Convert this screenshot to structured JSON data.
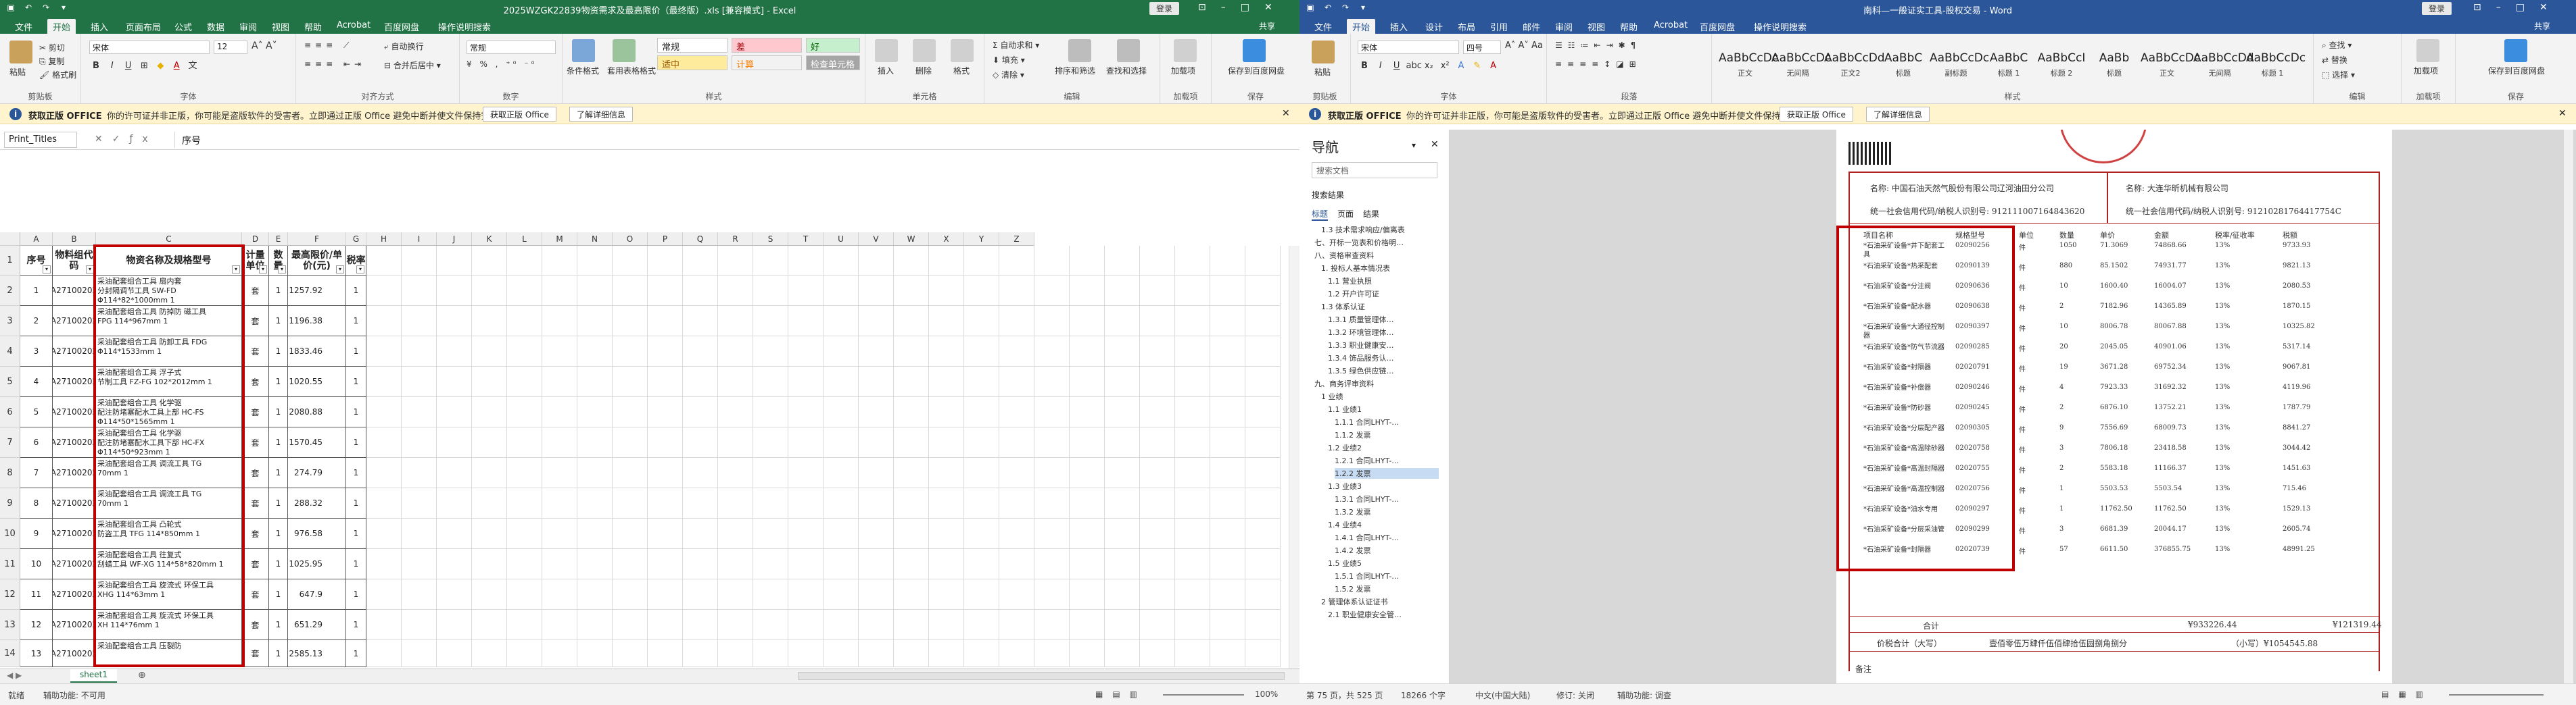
{
  "excel": {
    "title": "2025WZGK22839物资需求及最高限价（最终版）.xls [兼容模式] - Excel",
    "login": "登录",
    "tabs": [
      "文件",
      "开始",
      "插入",
      "页面布局",
      "公式",
      "数据",
      "审阅",
      "视图",
      "帮助",
      "Acrobat",
      "百度网盘",
      "操作说明搜索"
    ],
    "share": "共享",
    "ribbon": {
      "clipboard": {
        "paste": "粘贴",
        "cut": "剪切",
        "copy": "复制",
        "painter": "格式刷",
        "label": "剪贴板"
      },
      "font": {
        "name": "宋体",
        "size": "12",
        "label": "字体"
      },
      "align": {
        "wrap": "自动换行",
        "merge": "合并后居中",
        "label": "对齐方式"
      },
      "number": {
        "format": "常规",
        "label": "数字"
      },
      "styles": {
        "cond": "条件格式",
        "table": "套用表格格式",
        "normal": "常规",
        "bad": "差",
        "good": "好",
        "neutral": "适中",
        "calc": "计算",
        "check": "检查单元格",
        "label": "样式"
      },
      "cells": {
        "insert": "插入",
        "delete": "删除",
        "format": "格式",
        "label": "单元格"
      },
      "edit": {
        "autosum": "自动求和",
        "fill": "填充",
        "clear": "清除",
        "sort": "排序和筛选",
        "find": "查找和选择",
        "label": "编辑"
      },
      "addin": {
        "btn": "加载项",
        "label": "加载项"
      },
      "save": {
        "btn": "保存到百度网盘",
        "label": "保存"
      }
    },
    "msgbar": {
      "title": "获取正版 OFFICE",
      "text": "你的许可证并非正版，你可能是盗版软件的受害者。立即通过正版 Office 避免中断并使文件保持安全。",
      "btn1": "获取正版 Office",
      "btn2": "了解详细信息"
    },
    "namebox": "Print_Titles",
    "formula": "序号",
    "columns": [
      "A",
      "B",
      "C",
      "D",
      "E",
      "F",
      "G",
      "H",
      "I",
      "J",
      "K",
      "L",
      "M",
      "N",
      "O",
      "P",
      "Q",
      "R",
      "S",
      "T",
      "U",
      "V",
      "W",
      "X",
      "Y",
      "Z"
    ],
    "headers": [
      "序号",
      "物料组代码",
      "物资名称及规格型号",
      "计量单位",
      "数量",
      "最高限价/单价(元)",
      "税率"
    ],
    "rows": [
      {
        "no": "1",
        "code": "A27100202",
        "name": "采油配套组合工具 扇内套\n分封隔调节工具 SW-FD\nΦ114*82*1000mm 1",
        "unit": "套",
        "qty": "1",
        "price": "1257.92",
        "tax": "1"
      },
      {
        "no": "2",
        "code": "A27100202",
        "name": "采油配套组合工具 防掉防 磁工具\nFPG 114*967mm 1",
        "unit": "套",
        "qty": "1",
        "price": "1196.38",
        "tax": "1"
      },
      {
        "no": "3",
        "code": "A27100202",
        "name": "采油配套组合工具 防卸工具 FDG\nΦ114*1533mm 1",
        "unit": "套",
        "qty": "1",
        "price": "1833.46",
        "tax": "1"
      },
      {
        "no": "4",
        "code": "A27100202",
        "name": "采油配套组合工具 浮子式\n节制工具 FZ-FG 102*2012mm 1",
        "unit": "套",
        "qty": "1",
        "price": "1020.55",
        "tax": "1"
      },
      {
        "no": "5",
        "code": "A27100202",
        "name": "采油配套组合工具 化学驱\n配注防堵塞配水工具上部 HC-FS\nΦ114*50*1565mm 1",
        "unit": "套",
        "qty": "1",
        "price": "2080.88",
        "tax": "1"
      },
      {
        "no": "6",
        "code": "A27100202",
        "name": "采油配套组合工具 化学驱\n配注防堵塞配水工具下部 HC-FX\nΦ114*50*923mm 1",
        "unit": "套",
        "qty": "1",
        "price": "1570.45",
        "tax": "1"
      },
      {
        "no": "7",
        "code": "A27100202",
        "name": "采油配套组合工具 调流工具 TG\n70mm 1",
        "unit": "套",
        "qty": "1",
        "price": "274.79",
        "tax": "1"
      },
      {
        "no": "8",
        "code": "A27100202",
        "name": "采油配套组合工具 调流工具 TG\n70mm 1",
        "unit": "套",
        "qty": "1",
        "price": "288.32",
        "tax": "1"
      },
      {
        "no": "9",
        "code": "A27100202",
        "name": "采油配套组合工具 凸轮式\n防盗工具 TFG 114*850mm 1",
        "unit": "套",
        "qty": "1",
        "price": "976.58",
        "tax": "1"
      },
      {
        "no": "10",
        "code": "A27100202",
        "name": "采油配套组合工具 往复式\n刮蜡工具 WF-XG 114*58*820mm 1",
        "unit": "套",
        "qty": "1",
        "price": "1025.95",
        "tax": "1"
      },
      {
        "no": "11",
        "code": "A27100202",
        "name": "采油配套组合工具 旋流式 环保工具\nXHG 114*63mm 1",
        "unit": "套",
        "qty": "1",
        "price": "647.9",
        "tax": "1"
      },
      {
        "no": "12",
        "code": "A27100202",
        "name": "采油配套组合工具 旋流式 环保工具\nXH 114*76mm 1",
        "unit": "套",
        "qty": "1",
        "price": "651.29",
        "tax": "1"
      },
      {
        "no": "13",
        "code": "A27100202",
        "name": "采油配套组合工具 压裂防",
        "unit": "套",
        "qty": "1",
        "price": "2585.13",
        "tax": "1"
      }
    ],
    "sheet": "sheet1",
    "status": {
      "ready": "就绪",
      "access": "辅助功能: 不可用",
      "zoom": "100%"
    }
  },
  "word": {
    "title": "南科—一般证实工具-股权交易 - Word",
    "login": "登录",
    "tabs": [
      "文件",
      "开始",
      "插入",
      "设计",
      "布局",
      "引用",
      "邮件",
      "审阅",
      "视图",
      "帮助",
      "Acrobat",
      "百度网盘",
      "操作说明搜索"
    ],
    "share": "共享",
    "ribbon": {
      "clipboard": {
        "paste": "粘贴",
        "label": "剪贴板"
      },
      "font": {
        "name": "宋体",
        "size": "四号",
        "label": "字体"
      },
      "para": {
        "label": "段落"
      },
      "styles": {
        "items": [
          {
            "prev": "AaBbCcDc",
            "name": "正文"
          },
          {
            "prev": "AaBbCcDc",
            "name": "无间隔"
          },
          {
            "prev": "AaBbCcDd",
            "name": "正文2"
          },
          {
            "prev": "AaBbC",
            "name": "标题"
          },
          {
            "prev": "AaBbCcDc",
            "name": "副标题"
          },
          {
            "prev": "AaBbC",
            "name": "标题 1"
          },
          {
            "prev": "AaBbCcI",
            "name": "标题 2"
          },
          {
            "prev": "AaBb",
            "name": "标题"
          },
          {
            "prev": "AaBbCcDc",
            "name": "正文"
          },
          {
            "prev": "AaBbCcDd",
            "name": "无间隔"
          },
          {
            "prev": "AaBbCcDc",
            "name": "标题 1"
          }
        ],
        "label": "样式"
      },
      "edit": {
        "find": "查找",
        "replace": "替换",
        "select": "选择",
        "label": "编辑"
      },
      "addin": {
        "btn": "加载项",
        "label": "加载项"
      },
      "save": {
        "btn": "保存到百度网盘",
        "label": "保存"
      }
    },
    "msgbar": {
      "title": "获取正版 OFFICE",
      "text": "你的许可证并非正版，你可能是盗版软件的受害者。立即通过正版 Office 避免中断并使文件保持安全。",
      "btn1": "获取正版 Office",
      "btn2": "了解详细信息"
    },
    "nav": {
      "title": "导航",
      "search": "搜索文档",
      "results": "搜索结果",
      "tabs": [
        "标题",
        "页面",
        "结果"
      ],
      "items": [
        {
          "text": "1.3 技术需求响应/偏离表",
          "lvl": 2
        },
        {
          "text": "七、开标一览表和价格明…",
          "lvl": 1
        },
        {
          "text": "八、资格审查资料",
          "lvl": 1
        },
        {
          "text": "1. 投标人基本情况表",
          "lvl": 2
        },
        {
          "text": "1.1 营业执照",
          "lvl": 3
        },
        {
          "text": "1.2 开户许可证",
          "lvl": 3
        },
        {
          "text": "1.3 体系认证",
          "lvl": 2
        },
        {
          "text": "1.3.1 质量管理体…",
          "lvl": 3
        },
        {
          "text": "1.3.2 环境管理体…",
          "lvl": 3
        },
        {
          "text": "1.3.3 职业健康安…",
          "lvl": 3
        },
        {
          "text": "1.3.4 饰品服务认…",
          "lvl": 3
        },
        {
          "text": "1.3.5 绿色供应链…",
          "lvl": 3
        },
        {
          "text": "九、商务评审资料",
          "lvl": 1
        },
        {
          "text": "1 业绩",
          "lvl": 2
        },
        {
          "text": "1.1 业绩1",
          "lvl": 3
        },
        {
          "text": "1.1.1 合同LHYT-…",
          "lvl": 4
        },
        {
          "text": "1.1.2 发票",
          "lvl": 4
        },
        {
          "text": "1.2 业绩2",
          "lvl": 3
        },
        {
          "text": "1.2.1 合同LHYT-…",
          "lvl": 4
        },
        {
          "text": "1.2.2 发票",
          "lvl": 4,
          "sel": true
        },
        {
          "text": "1.3 业绩3",
          "lvl": 3
        },
        {
          "text": "1.3.1 合同LHYT-…",
          "lvl": 4
        },
        {
          "text": "1.3.2 发票",
          "lvl": 4
        },
        {
          "text": "1.4 业绩4",
          "lvl": 3
        },
        {
          "text": "1.4.1 合同LHYT-…",
          "lvl": 4
        },
        {
          "text": "1.4.2 发票",
          "lvl": 4
        },
        {
          "text": "1.5 业绩5",
          "lvl": 3
        },
        {
          "text": "1.5.1 合同LHYT-…",
          "lvl": 4
        },
        {
          "text": "1.5.2 发票",
          "lvl": 4
        },
        {
          "text": "2 管理体系认证证书",
          "lvl": 2
        },
        {
          "text": "2.1 职业健康安全管…",
          "lvl": 3
        }
      ]
    },
    "invoice": {
      "buyer": "名称: 中国石油天然气股份有限公司辽河油田分公司",
      "buyer_id": "统一社会信用代码/纳税人识别号: 912111007164843620",
      "seller": "名称: 大连华昕机械有限公司",
      "seller_id": "统一社会信用代码/纳税人识别号: 91210281764417754C",
      "cols": [
        "项目名称",
        "规格型号",
        "单位",
        "数量",
        "单价",
        "金额",
        "税率/征收率",
        "税额"
      ],
      "rows": [
        {
          "name": "*石油采矿设备*井下配套工具",
          "model": "02090256",
          "unit": "件",
          "qty": "1050",
          "price": "71.3069",
          "amt": "74868.66",
          "rate": "13%",
          "tax": "9733.93"
        },
        {
          "name": "*石油采矿设备*热采配套",
          "model": "02090139",
          "unit": "件",
          "qty": "880",
          "price": "85.1502",
          "amt": "74931.77",
          "rate": "13%",
          "tax": "9821.13"
        },
        {
          "name": "*石油采矿设备*分注阀",
          "model": "02090636",
          "unit": "件",
          "qty": "10",
          "price": "1600.40",
          "amt": "16004.07",
          "rate": "13%",
          "tax": "2080.53"
        },
        {
          "name": "*石油采矿设备*配水器",
          "model": "02090638",
          "unit": "件",
          "qty": "2",
          "price": "7182.96",
          "amt": "14365.89",
          "rate": "13%",
          "tax": "1870.15"
        },
        {
          "name": "*石油采矿设备*大通径控制器",
          "model": "02090397",
          "unit": "件",
          "qty": "10",
          "price": "8006.78",
          "amt": "80067.88",
          "rate": "13%",
          "tax": "10325.82"
        },
        {
          "name": "*石油采矿设备*防气节流器",
          "model": "02090285",
          "unit": "件",
          "qty": "20",
          "price": "2045.05",
          "amt": "40901.06",
          "rate": "13%",
          "tax": "5317.14"
        },
        {
          "name": "*石油采矿设备*封隔器",
          "model": "02020791",
          "unit": "件",
          "qty": "19",
          "price": "3671.28",
          "amt": "69752.34",
          "rate": "13%",
          "tax": "9067.81"
        },
        {
          "name": "*石油采矿设备*补偿器",
          "model": "02090246",
          "unit": "件",
          "qty": "4",
          "price": "7923.33",
          "amt": "31692.32",
          "rate": "13%",
          "tax": "4119.96"
        },
        {
          "name": "*石油采矿设备*防砂器",
          "model": "02090245",
          "unit": "件",
          "qty": "2",
          "price": "6876.10",
          "amt": "13752.21",
          "rate": "13%",
          "tax": "1787.79"
        },
        {
          "name": "*石油采矿设备*分层配产器",
          "model": "02090305",
          "unit": "件",
          "qty": "9",
          "price": "7556.69",
          "amt": "68009.73",
          "rate": "13%",
          "tax": "8841.27"
        },
        {
          "name": "*石油采矿设备*高温除砂器",
          "model": "02020758",
          "unit": "件",
          "qty": "3",
          "price": "7806.18",
          "amt": "23418.58",
          "rate": "13%",
          "tax": "3044.42"
        },
        {
          "name": "*石油采矿设备*高温封隔器",
          "model": "02020755",
          "unit": "件",
          "qty": "2",
          "price": "5583.18",
          "amt": "11166.37",
          "rate": "13%",
          "tax": "1451.63"
        },
        {
          "name": "*石油采矿设备*高温控制器",
          "model": "02020756",
          "unit": "件",
          "qty": "1",
          "price": "5503.53",
          "amt": "5503.54",
          "rate": "13%",
          "tax": "715.46"
        },
        {
          "name": "*石油采矿设备*油水专用",
          "model": "02090297",
          "unit": "件",
          "qty": "1",
          "price": "11762.50",
          "amt": "11762.50",
          "rate": "13%",
          "tax": "1529.13"
        },
        {
          "name": "*石油采矿设备*分层采油管",
          "model": "02090299",
          "unit": "件",
          "qty": "3",
          "price": "6681.39",
          "amt": "20044.17",
          "rate": "13%",
          "tax": "2605.74"
        },
        {
          "name": "*石油采矿设备*封隔器",
          "model": "02020739",
          "unit": "件",
          "qty": "57",
          "price": "6611.50",
          "amt": "376855.75",
          "rate": "13%",
          "tax": "48991.25"
        }
      ],
      "total_label": "合计",
      "total_amt": "¥933226.44",
      "total_tax": "¥121319.44",
      "sum_label": "价税合计（大写）",
      "sum_cn": "壹佰零伍万肆仟伍佰肆拾伍圆捌角捌分",
      "sum_num": "（小写）¥1054545.88",
      "note_label": "备注"
    },
    "status": {
      "page": "第 75 页，共 525 页",
      "words": "18266 个字",
      "lang": "中文(中国大陆)",
      "track": "修订: 关闭",
      "access": "辅助功能: 调查"
    }
  }
}
